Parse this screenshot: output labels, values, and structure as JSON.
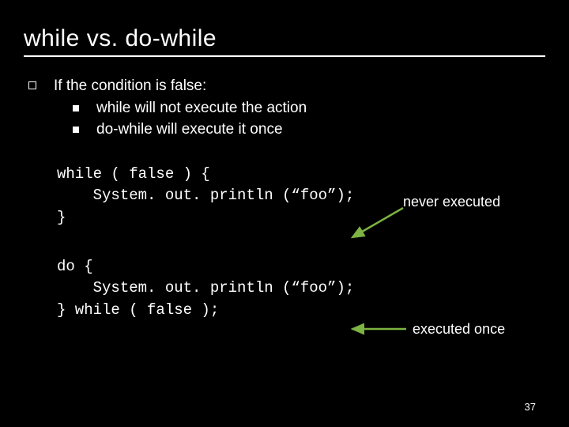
{
  "title": "while vs. do-while",
  "intro": "If the condition is false:",
  "sub": [
    "while will not execute the action",
    "do-while will execute it once"
  ],
  "code1": {
    "l1": "while ( false ) {",
    "l2": "    System. out. println (“foo”);",
    "l3": "}"
  },
  "code2": {
    "l1": "do {",
    "l2": "    System. out. println (“foo”);",
    "l3": "} while ( false );"
  },
  "annotation1": "never executed",
  "annotation2": "executed once",
  "page_number": "37",
  "arrow_color": "#7CB342"
}
